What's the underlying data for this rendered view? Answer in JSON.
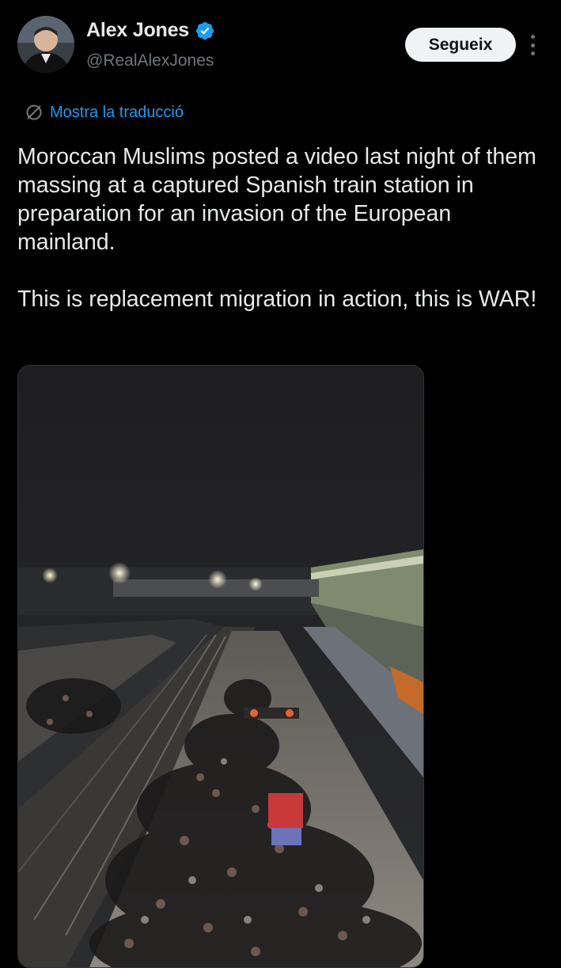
{
  "author": {
    "display_name": "Alex Jones",
    "handle": "@RealAlexJones",
    "verified": true,
    "verified_color": "#1d9bf0"
  },
  "actions": {
    "follow_label": "Segueix",
    "more_icon": "more-vertical-icon"
  },
  "translate": {
    "label": "Mostra la traducció",
    "icon": "translate-globe-icon"
  },
  "tweet": {
    "paragraphs": [
      "Moroccan Muslims posted a video last night of them massing at a captured Spanish train station in preparation for an invasion of the European mainland.",
      "This is replacement migration in action, this is WAR!"
    ]
  },
  "media": {
    "type": "video",
    "icon": "video-thumbnail-icon"
  },
  "colors": {
    "background": "#000000",
    "text_primary": "#e7e9ea",
    "text_secondary": "#71767b",
    "accent": "#1d9bf0"
  }
}
